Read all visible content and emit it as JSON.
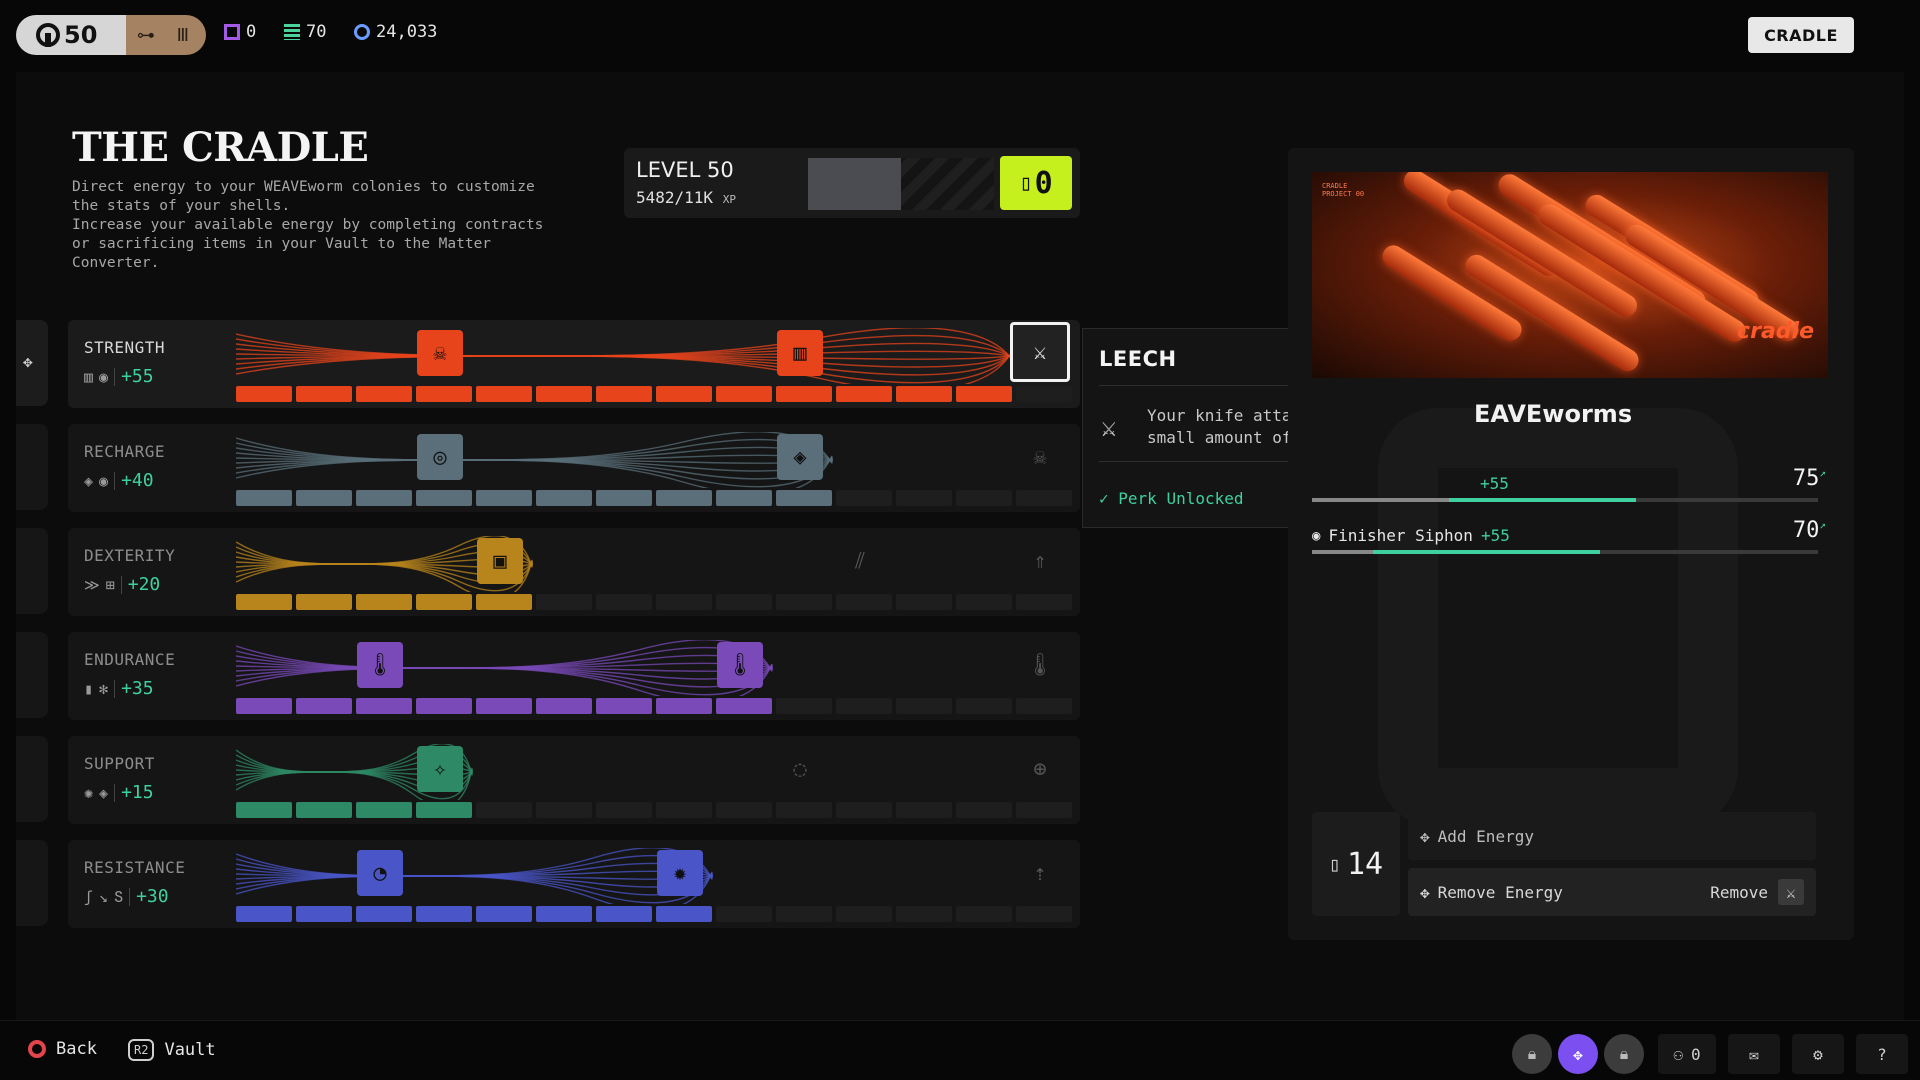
{
  "topbar": {
    "level": "50",
    "stats": [
      {
        "icon": "matter-icon",
        "value": "0"
      },
      {
        "icon": "contracts-icon",
        "value": "70"
      },
      {
        "icon": "currency-icon",
        "value": "24,033"
      }
    ],
    "cradle_button": "CRADLE"
  },
  "page": {
    "title": "THE CRADLE",
    "description": [
      "Direct energy to your WEAVEworm colonies to customize",
      "the stats of your shells.",
      "Increase your available energy by completing contracts",
      "or sacrificing items in your Vault to the Matter",
      "Converter."
    ]
  },
  "level_box": {
    "level_label": "LEVEL 50",
    "xp_text": "5482/11K",
    "xp_unit": "XP",
    "xp_progress": 0.498,
    "energy_available": "0"
  },
  "stats": [
    {
      "name": "STRENGTH",
      "icons": [
        "▥",
        "◉"
      ],
      "bonus": "+55",
      "color": "#e8441c",
      "filled": 13,
      "active": true
    },
    {
      "name": "RECHARGE",
      "icons": [
        "◈",
        "◉"
      ],
      "bonus": "+40",
      "color": "#5a6f7a",
      "filled": 10,
      "active": false
    },
    {
      "name": "DEXTERITY",
      "icons": [
        "≫",
        "⊞"
      ],
      "bonus": "+20",
      "color": "#b8841c",
      "filled": 5,
      "active": false
    },
    {
      "name": "ENDURANCE",
      "icons": [
        "▮",
        "✻"
      ],
      "bonus": "+35",
      "color": "#7a4ab8",
      "filled": 9,
      "active": false
    },
    {
      "name": "SUPPORT",
      "icons": [
        "✺",
        "◈"
      ],
      "bonus": "+15",
      "color": "#2e8a66",
      "filled": 4,
      "active": false
    },
    {
      "name": "RESISTANCE",
      "icons": [
        "ʃ",
        "↘",
        "Տ"
      ],
      "bonus": "+30",
      "color": "#4a56c8",
      "filled": 8,
      "active": false
    }
  ],
  "tooltip": {
    "title": "LEECH",
    "description": "Your knife attacks restore a small amount of health.",
    "status": "Perk Unlocked"
  },
  "right_panel": {
    "hero_logo": "cradle",
    "hero_fine_text": [
      "CRADLE",
      "PROJECT 00"
    ],
    "title": "EAVEworms",
    "perk_stats": [
      {
        "label": "",
        "bonus": "+55",
        "value": "75",
        "base": 0.27,
        "fill": 0.64
      },
      {
        "label": "Finisher Siphon",
        "bonus": "+55",
        "value": "70",
        "base": 0.12,
        "fill": 0.57
      }
    ],
    "energy_count": "14",
    "add_energy": "Add Energy",
    "remove_energy": "Remove Energy",
    "remove_hint": "Remove"
  },
  "bottombar": {
    "back": "Back",
    "r2": "R2",
    "vault": "Vault",
    "squad_count": "0"
  }
}
